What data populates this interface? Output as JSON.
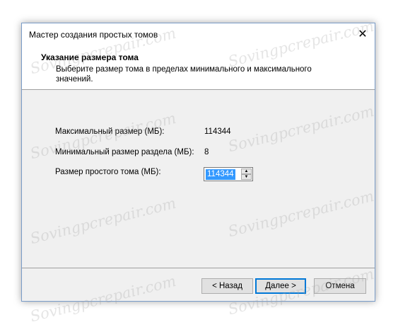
{
  "window": {
    "title": "Мастер создания простых томов"
  },
  "header": {
    "title": "Указание размера тома",
    "subtitle": "Выберите размер тома в пределах минимального и максимального значений."
  },
  "fields": {
    "max_label": "Максимальный размер (МБ):",
    "max_value": "114344",
    "min_label": "Минимальный размер раздела (МБ):",
    "min_value": "8",
    "size_label": "Размер простого тома (МБ):",
    "size_value": "114344"
  },
  "buttons": {
    "back": "< Назад",
    "next": "Далее >",
    "cancel": "Отмена"
  },
  "watermark": "Sovingpcrepair.com",
  "icons": {
    "close": "close-icon",
    "spin_up": "triangle-up-icon",
    "spin_down": "triangle-down-icon"
  }
}
